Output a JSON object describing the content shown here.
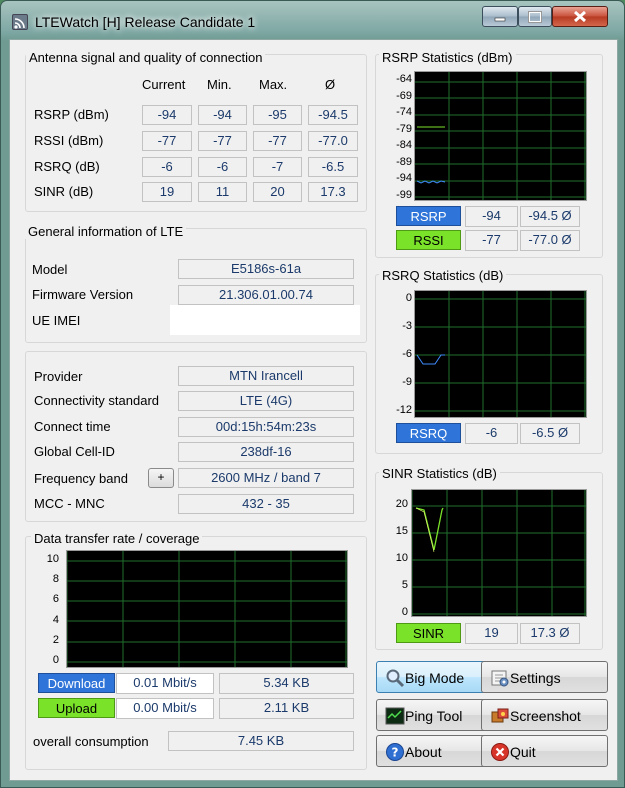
{
  "window": {
    "title": "LTEWatch [H]   Release Candidate 1"
  },
  "antenna": {
    "title": "Antenna signal and quality of connection",
    "headers": [
      "Current",
      "Min.",
      "Max.",
      "Ø"
    ],
    "rows": [
      {
        "label": "RSRP (dBm)",
        "current": "-94",
        "min": "-94",
        "max": "-95",
        "avg": "-94.5"
      },
      {
        "label": "RSSI (dBm)",
        "current": "-77",
        "min": "-77",
        "max": "-77",
        "avg": "-77.0"
      },
      {
        "label": "RSRQ (dB)",
        "current": "-6",
        "min": "-6",
        "max": "-7",
        "avg": "-6.5"
      },
      {
        "label": "SINR (dB)",
        "current": "19",
        "min": "11",
        "max": "20",
        "avg": "17.3"
      }
    ]
  },
  "general": {
    "title": "General information of LTE",
    "model_label": "Model",
    "model": "E5186s-61a",
    "firmware_label": "Firmware Version",
    "firmware": "21.306.01.00.74",
    "imei_label": "UE IMEI"
  },
  "network": {
    "provider_label": "Provider",
    "provider": "MTN Irancell",
    "standard_label": "Connectivity standard",
    "standard": "LTE (4G)",
    "time_label": "Connect time",
    "time": "00d:15h:54m:23s",
    "cell_label": "Global Cell-ID",
    "cell": "238df-16",
    "band_label": "Frequency band",
    "band_button": "+",
    "band": "2600 MHz / band 7",
    "mcc_label": "MCC - MNC",
    "mcc": "432 - 35"
  },
  "transfer": {
    "title": "Data transfer rate / coverage",
    "yticks": [
      "10",
      "8",
      "6",
      "4",
      "2",
      "0"
    ],
    "download_label": "Download",
    "download_rate": "0.01 Mbit/s",
    "download_total": "5.34 KB",
    "upload_label": "Upload",
    "upload_rate": "0.00 Mbit/s",
    "upload_total": "2.11 KB",
    "overall_label": "overall consumption",
    "overall": "7.45 KB",
    "colors": {
      "download": "#2f74d8",
      "upload": "#7be22a"
    }
  },
  "rsrp_stats": {
    "title": "RSRP Statistics (dBm)",
    "yticks": [
      "-64",
      "-69",
      "-74",
      "-79",
      "-84",
      "-89",
      "-94",
      "-99"
    ],
    "rsrp_label": "RSRP",
    "rsrp": "-94",
    "rsrp_avg": "-94.5 Ø",
    "rssi_label": "RSSI",
    "rssi": "-77",
    "rssi_avg": "-77.0 Ø"
  },
  "rsrq_stats": {
    "title": "RSRQ Statistics (dB)",
    "yticks": [
      "0",
      "-3",
      "-6",
      "-9",
      "-12"
    ],
    "rsrq_label": "RSRQ",
    "rsrq": "-6",
    "rsrq_avg": "-6.5 Ø"
  },
  "sinr_stats": {
    "title": "SINR Statistics (dB)",
    "yticks": [
      "20",
      "15",
      "10",
      "5",
      "0"
    ],
    "sinr_label": "SINR",
    "sinr": "19",
    "sinr_avg": "17.3 Ø"
  },
  "buttons": {
    "big_mode": "Big Mode",
    "settings": "Settings",
    "ping_tool": "Ping Tool",
    "screenshot": "Screenshot",
    "about": "About",
    "quit": "Quit"
  }
}
